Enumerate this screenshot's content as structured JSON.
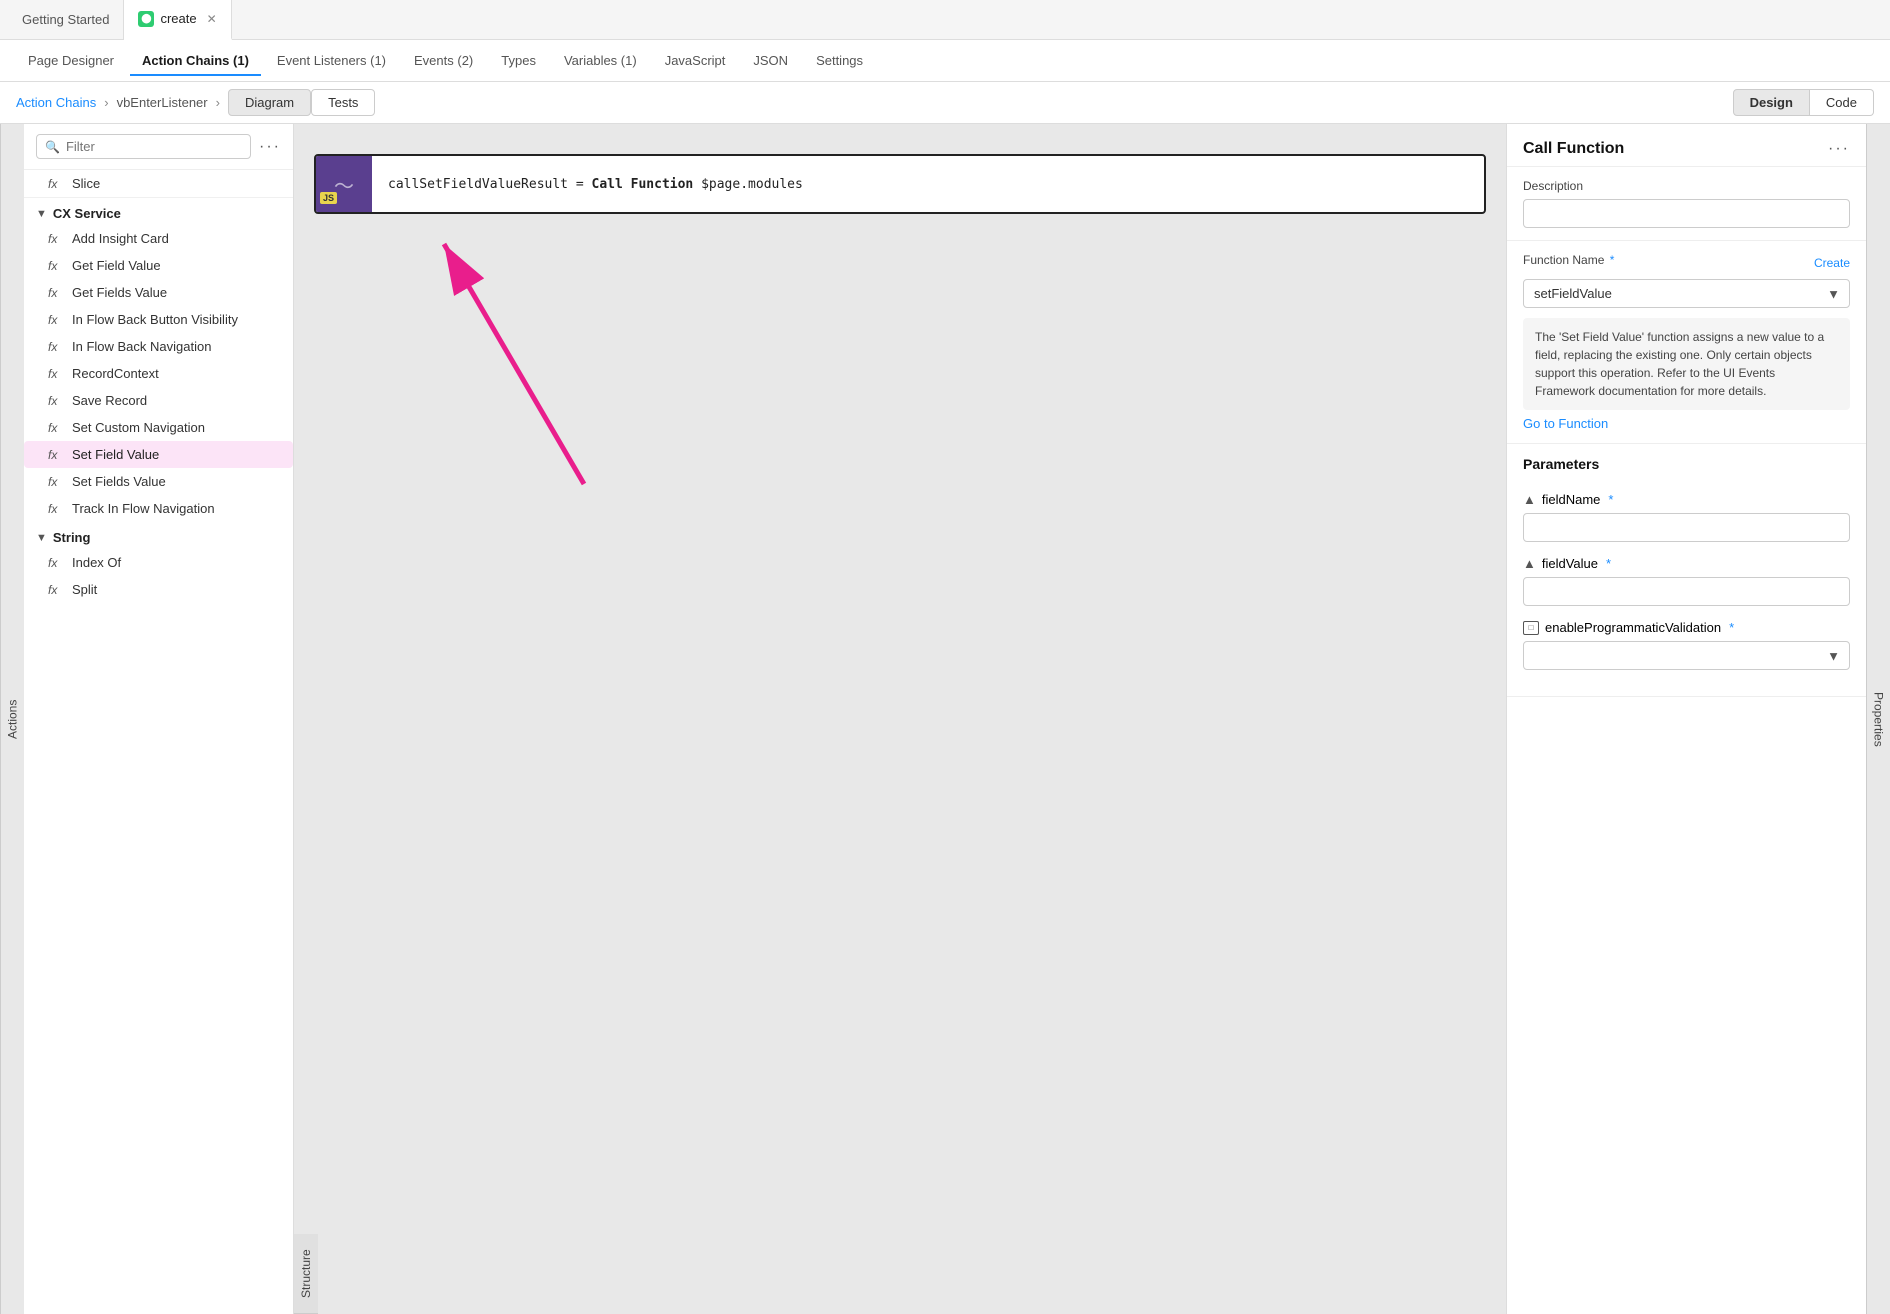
{
  "topTabs": {
    "tab1": {
      "label": "Getting Started",
      "active": false
    },
    "tab2": {
      "label": "create",
      "active": true,
      "icon": "circle-icon",
      "closable": true
    }
  },
  "navBar": {
    "items": [
      {
        "label": "Page Designer",
        "active": false
      },
      {
        "label": "Action Chains (1)",
        "active": true
      },
      {
        "label": "Event Listeners (1)",
        "active": false
      },
      {
        "label": "Events (2)",
        "active": false
      },
      {
        "label": "Types",
        "active": false
      },
      {
        "label": "Variables (1)",
        "active": false
      },
      {
        "label": "JavaScript",
        "active": false
      },
      {
        "label": "JSON",
        "active": false
      },
      {
        "label": "Settings",
        "active": false
      }
    ]
  },
  "breadcrumb": {
    "link": "Action Chains",
    "separator": ">",
    "current": "vbEnterListener",
    "separator2": ">",
    "tab1": "Diagram",
    "tab2": "Tests",
    "designLabel": "Design",
    "codeLabel": "Code"
  },
  "leftPanel": {
    "filterPlaceholder": "Filter",
    "moreLabel": "···",
    "sliceLabel": "Slice",
    "sections": [
      {
        "title": "CX Service",
        "items": [
          "Add Insight Card",
          "Get Field Value",
          "Get Fields Value",
          "In Flow Back Button Visibility",
          "In Flow Back Navigation",
          "RecordContext",
          "Save Record",
          "Set Custom Navigation",
          "Set Field Value",
          "Set Fields Value",
          "Track In Flow Navigation"
        ]
      },
      {
        "title": "String",
        "items": [
          "Index Of",
          "Split"
        ]
      }
    ]
  },
  "diagramNode": {
    "iconLabel": "JS",
    "codeText": "callSetFieldValueResult = ",
    "boldText": "Call Function",
    "restText": " $page.modules"
  },
  "rightPanel": {
    "title": "Call Function",
    "moreLabel": "···",
    "descriptionLabel": "Description",
    "functionNameLabel": "Function Name",
    "requiredMark": "*",
    "createLabel": "Create",
    "selectedFunction": "setFieldValue",
    "functionDescription": "The 'Set Field Value' function assigns a new value to a field, replacing the existing one. Only certain objects support this operation. Refer to the UI Events Framework documentation for more details.",
    "goToFunctionLabel": "Go to Function",
    "parametersLabel": "Parameters",
    "params": [
      {
        "name": "fieldName",
        "required": true,
        "type": "text"
      },
      {
        "name": "fieldValue",
        "required": true,
        "type": "text"
      },
      {
        "name": "enableProgrammaticValidation",
        "required": true,
        "type": "checkbox"
      }
    ]
  },
  "sideLabels": {
    "actions": "Actions",
    "properties": "Properties",
    "structure": "Structure"
  }
}
